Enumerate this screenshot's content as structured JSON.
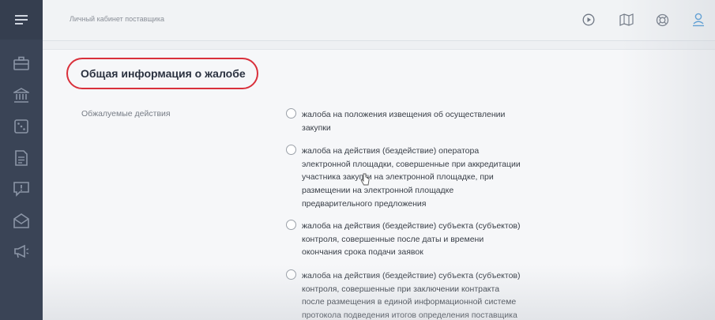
{
  "header": {
    "cabinet_title": "Личный кабинет поставщика"
  },
  "sidebar": {
    "items": [
      {
        "icon": "briefcase-icon"
      },
      {
        "icon": "bank-icon"
      },
      {
        "icon": "dice-icon"
      },
      {
        "icon": "document-icon"
      },
      {
        "icon": "alert-message-icon"
      },
      {
        "icon": "open-mail-icon"
      },
      {
        "icon": "megaphone-icon"
      }
    ]
  },
  "toolbar": {
    "icons": [
      "play-icon",
      "map-icon",
      "help-lifebuoy-icon",
      "user-icon"
    ]
  },
  "section": {
    "title": "Общая информация о жалобе",
    "field_label": "Обжалуемые действия",
    "options": [
      {
        "lines": [
          "жалоба на положения извещения об осуществлении",
          "закупки"
        ]
      },
      {
        "lines": [
          "жалоба на действия (бездействие) оператора",
          "электронной площадки, совершенные при аккредитации",
          "участника закупки на электронной площадке, при",
          "размещении на электронной площадке",
          "предварительного предложения"
        ]
      },
      {
        "lines": [
          "жалоба на действия (бездействие) субъекта (субъектов)",
          "контроля, совершенные после даты и времени",
          "окончания срока подачи заявок"
        ]
      },
      {
        "lines": [
          "жалоба на действия (бездействие) субъекта (субъектов)",
          "контроля, совершенные при заключении контракта",
          "после размещения в единой информационной системе",
          "протокола подведения итогов определения поставщика"
        ]
      }
    ]
  },
  "colors": {
    "sidebar": "#3a4456",
    "highlight_circle": "#d9303b",
    "accent_blue": "#3b8fd4"
  }
}
